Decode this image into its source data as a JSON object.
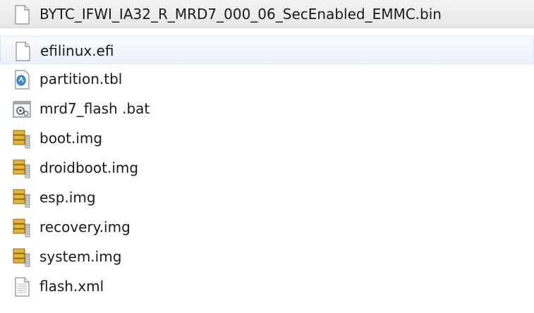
{
  "files": [
    {
      "name": "BYTC_IFWI_IA32_R_MRD7_000_06_SecEnabled_EMMC.bin",
      "icon": "blank-file-icon"
    },
    {
      "name": "efilinux.efi",
      "icon": "blank-file-icon"
    },
    {
      "name": "partition.tbl",
      "icon": "table-file-icon"
    },
    {
      "name": "mrd7_flash .bat",
      "icon": "batch-file-icon"
    },
    {
      "name": "boot.img",
      "icon": "disk-image-icon"
    },
    {
      "name": "droidboot.img",
      "icon": "disk-image-icon"
    },
    {
      "name": "esp.img",
      "icon": "disk-image-icon"
    },
    {
      "name": "recovery.img",
      "icon": "disk-image-icon"
    },
    {
      "name": "system.img",
      "icon": "disk-image-icon"
    },
    {
      "name": "flash.xml",
      "icon": "text-file-icon"
    }
  ]
}
